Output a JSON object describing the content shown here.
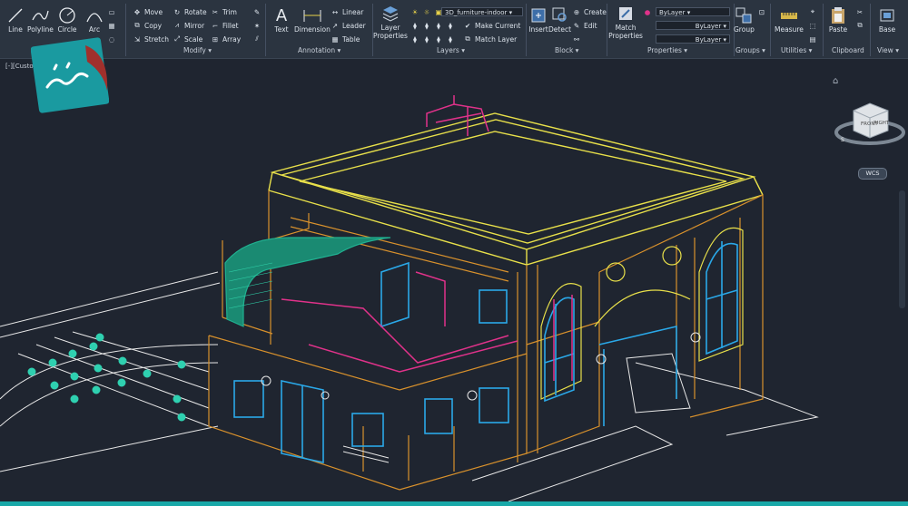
{
  "ribbon": {
    "draw": {
      "line": "Line",
      "polyline": "Polyline",
      "circle": "Circle",
      "arc": "Arc"
    },
    "modify": {
      "title": "Modify",
      "move": "Move",
      "rotate": "Rotate",
      "trim": "Trim",
      "copy": "Copy",
      "mirror": "Mirror",
      "fillet": "Fillet",
      "stretch": "Stretch",
      "scale": "Scale",
      "array": "Array"
    },
    "annotation": {
      "title": "Annotation",
      "text": "Text",
      "dimension": "Dimension",
      "linear": "Linear",
      "leader": "Leader",
      "table": "Table"
    },
    "layers": {
      "title": "Layers",
      "layer_properties": "Layer Properties",
      "current_layer": "3D_furniture-indoor",
      "make_current": "Make Current",
      "match_layer": "Match Layer"
    },
    "block": {
      "title": "Block",
      "insert": "Insert",
      "detect": "Detect",
      "create": "Create",
      "edit": "Edit"
    },
    "properties": {
      "title": "Properties",
      "match_properties": "Match Properties",
      "bylayer_1": "ByLayer",
      "bylayer_2": "ByLayer",
      "bylayer_3": "ByLayer"
    },
    "groups": {
      "title": "Groups",
      "group": "Group"
    },
    "utilities": {
      "title": "Utilities",
      "measure": "Measure"
    },
    "clipboard": {
      "title": "Clipboard",
      "paste": "Paste"
    },
    "view": {
      "title": "View",
      "base": "Base"
    }
  },
  "viewport": {
    "label": "[-][Custo",
    "wcs": "WCS",
    "cube_front": "FRONT",
    "cube_right": "RIGHT"
  },
  "colors": {
    "accent": "#18a8a8",
    "ribbon_bg": "#2b3440",
    "canvas_bg": "#1f2530",
    "yellow": "#e8e04a",
    "orange": "#d8912c",
    "blue": "#2aa8e8",
    "magenta": "#e0328a",
    "green": "#20b090",
    "white": "#e8e8e8"
  }
}
